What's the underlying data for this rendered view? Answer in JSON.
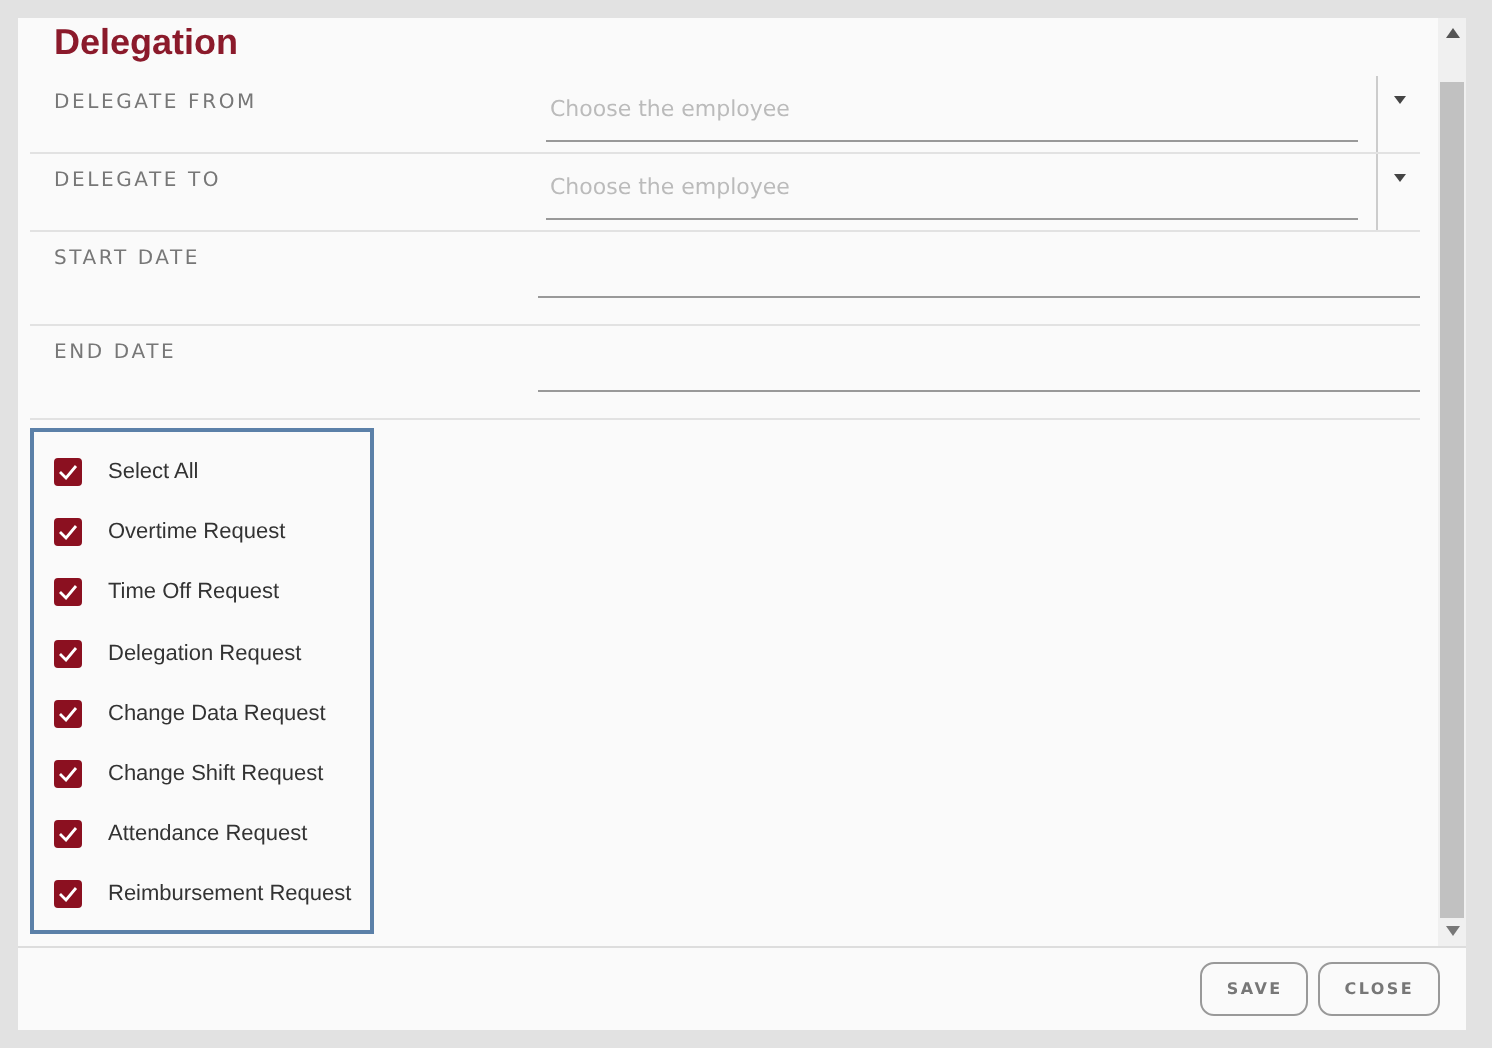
{
  "title": "Delegation",
  "fields": [
    {
      "label": "DELEGATE FROM",
      "kind": "select",
      "placeholder": "Choose the employee"
    },
    {
      "label": "DELEGATE TO",
      "kind": "select",
      "placeholder": "Choose the employee"
    },
    {
      "label": "START DATE",
      "kind": "date"
    },
    {
      "label": "END DATE",
      "kind": "date"
    }
  ],
  "request_types": [
    {
      "label": "Select All",
      "checked": true
    },
    {
      "label": "Overtime Request",
      "checked": true
    },
    {
      "label": "Time Off Request",
      "checked": true
    },
    {
      "label": "Delegation Request",
      "checked": true
    },
    {
      "label": "Change Data Request",
      "checked": true
    },
    {
      "label": "Change Shift Request",
      "checked": true
    },
    {
      "label": "Attendance Request",
      "checked": true
    },
    {
      "label": "Reimbursement Request",
      "checked": true
    }
  ],
  "buttons": [
    "SAVE",
    "CLOSE"
  ]
}
